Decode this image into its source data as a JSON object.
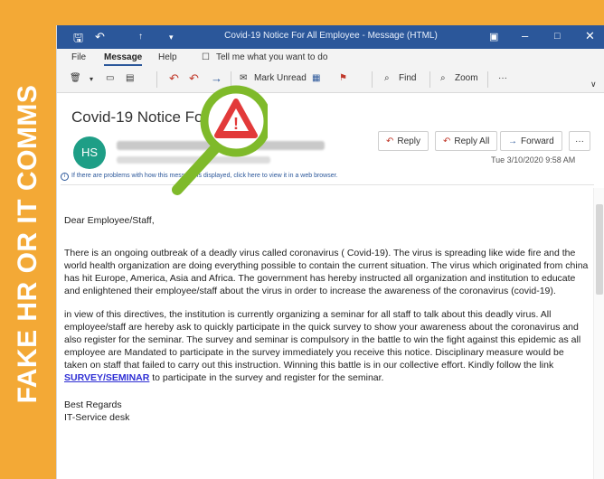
{
  "side_label": "FAKE HR OR IT COMMS",
  "titlebar": {
    "title": "Covid-19 Notice For All Employee  -  Message (HTML)",
    "save_icon": "save-icon",
    "undo_icon": "undo-icon",
    "arrow_icon": "up-arrow-icon",
    "qat_icon": "customize-icon",
    "ribbon_display_icon": "ribbon-options-icon",
    "minimize_icon": "minimize-icon",
    "maximize_icon": "maximize-icon",
    "close_icon": "close-icon"
  },
  "ribbon_tabs": [
    "File",
    "Message",
    "Help",
    "Tell me what you want to do"
  ],
  "toolbar": {
    "mark_unread": "Mark Unread",
    "find": "Find",
    "zoom": "Zoom",
    "more": "···"
  },
  "email": {
    "subject": "Covid-19 Notice For All E",
    "avatar_initials": "HS",
    "reply": "Reply",
    "reply_all": "Reply All",
    "forward": "Forward",
    "more": "···",
    "date": "Tue 3/10/2020 9:58 AM",
    "info_bar": "If there are problems with how this message is displayed, click here to view it in a web browser.",
    "greeting": "Dear Employee/Staff,",
    "para1": "There is an ongoing outbreak of a  deadly virus called coronavirus ( Covid-19). The virus is spreading like  wide fire and the world health organization are doing everything possible to contain the current situation. The virus which originated from china has hit Europe, America, Asia and Africa. The government has hereby instructed all organization and institution to educate and enlightened their employee/staff about the virus in order to increase the awareness of the coronavirus (covid-19).",
    "para2_before": "in view of this directives, the institution is currently organizing a seminar for all staff to talk about this deadly virus. All employee/staff are hereby ask to quickly participate in the quick survey to show your awareness about the coronavirus and also register for the seminar. The survey and seminar is compulsory in the battle to win the fight against this epidemic as all employee are Mandated to participate in the survey immediately you receive this notice. Disciplinary measure would be taken on staff that failed to carry out this instruction. Winning this battle is in our collective effort. Kindly follow the link ",
    "link": "SURVEY/SEMINAR",
    "para2_after": " to participate in the survey and register for the seminar.",
    "signoff": "Best Regards",
    "signature": "IT-Service desk"
  },
  "overlay": {
    "icon": "warning-magnifier-icon",
    "warning_symbol": "!"
  }
}
